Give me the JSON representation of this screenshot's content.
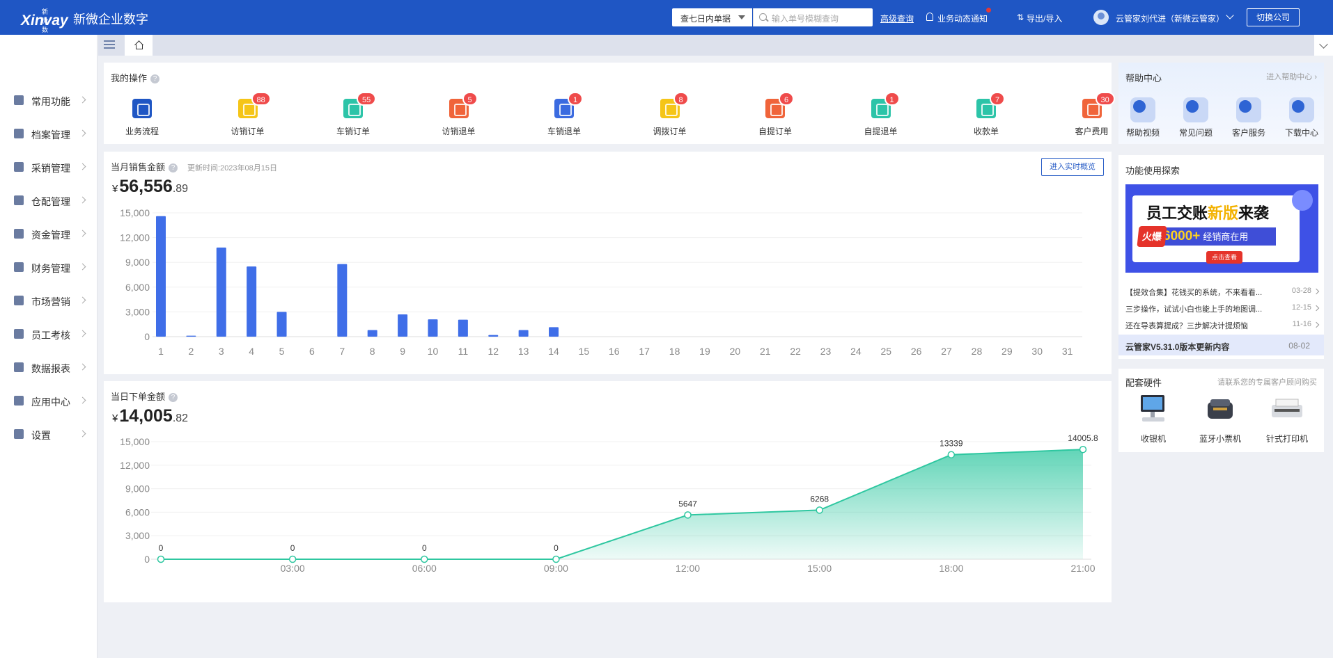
{
  "header": {
    "logo_text": "Xinvay",
    "logo_sub": "新微数字",
    "app_name": "新微企业数字",
    "scope_select": "查七日内单据",
    "search_placeholder": "输入单号模糊查询",
    "advanced_query": "高级查询",
    "notifications": "业务动态通知",
    "export_import": "导出/导入",
    "user": "云管家刘代进（新微云管家）",
    "switch_company": "切换公司",
    "brand_color": "#1f56c4"
  },
  "sidebar": {
    "items": [
      {
        "label": "常用功能",
        "icon": "star-icon"
      },
      {
        "label": "档案管理",
        "icon": "grid-icon"
      },
      {
        "label": "采销管理",
        "icon": "clipboard-icon"
      },
      {
        "label": "仓配管理",
        "icon": "warehouse-icon"
      },
      {
        "label": "资金管理",
        "icon": "money-bag-icon"
      },
      {
        "label": "财务管理",
        "icon": "calculator-icon"
      },
      {
        "label": "市场营销",
        "icon": "shop-icon"
      },
      {
        "label": "员工考核",
        "icon": "people-icon"
      },
      {
        "label": "数据报表",
        "icon": "chart-icon"
      },
      {
        "label": "应用中心",
        "icon": "apps-icon"
      },
      {
        "label": "设置",
        "icon": "gear-icon"
      }
    ]
  },
  "ops": {
    "title": "我的操作",
    "items": [
      {
        "label": "业务流程",
        "badge": "",
        "color": "#1f56c4"
      },
      {
        "label": "访销订单",
        "badge": "88",
        "color": "#f5c518"
      },
      {
        "label": "车销订单",
        "badge": "55",
        "color": "#2cc4a8"
      },
      {
        "label": "访销退单",
        "badge": "5",
        "color": "#f0643a"
      },
      {
        "label": "车销退单",
        "badge": "1",
        "color": "#3b6be0"
      },
      {
        "label": "调拨订单",
        "badge": "8",
        "color": "#f5c518"
      },
      {
        "label": "自提订单",
        "badge": "6",
        "color": "#f0643a"
      },
      {
        "label": "自提退单",
        "badge": "1",
        "color": "#2cc4a8"
      },
      {
        "label": "收款单",
        "badge": "7",
        "color": "#2cc4a8"
      },
      {
        "label": "客户费用",
        "badge": "30",
        "color": "#f0643a"
      }
    ]
  },
  "monthly": {
    "title": "当月销售金额",
    "updated": "更新时间:2023年08月15日",
    "currency": "¥",
    "amount_int": "56,556",
    "amount_dec": ".89",
    "realtime_button": "进入实时概览"
  },
  "daily": {
    "title": "当日下单金额",
    "currency": "¥",
    "amount_int": "14,005",
    "amount_dec": ".82"
  },
  "chart_data": [
    {
      "type": "bar",
      "categories": [
        "1",
        "2",
        "3",
        "4",
        "5",
        "6",
        "7",
        "8",
        "9",
        "10",
        "11",
        "12",
        "13",
        "14",
        "15",
        "16",
        "17",
        "18",
        "19",
        "20",
        "21",
        "22",
        "23",
        "24",
        "25",
        "26",
        "27",
        "28",
        "29",
        "30",
        "31"
      ],
      "values": [
        14600,
        120,
        10800,
        8500,
        3000,
        0,
        8800,
        800,
        2700,
        2100,
        2050,
        200,
        800,
        1150,
        0,
        0,
        0,
        0,
        0,
        0,
        0,
        0,
        0,
        0,
        0,
        0,
        0,
        0,
        0,
        0,
        0
      ],
      "yticks": [
        "0",
        "3,000",
        "6,000",
        "9,000",
        "12,000",
        "15,000"
      ],
      "ylim": [
        0,
        15000
      ],
      "color": "#3f6ee8"
    },
    {
      "type": "area",
      "x": [
        "00:00",
        "03:00",
        "06:00",
        "09:00",
        "12:00",
        "15:00",
        "18:00",
        "21:00"
      ],
      "xticks": [
        "03:00",
        "06:00",
        "09:00",
        "12:00",
        "15:00",
        "18:00",
        "21:00"
      ],
      "values": [
        0,
        0,
        0,
        0,
        5647,
        6268,
        13339,
        14005.8
      ],
      "labels": [
        "0",
        "0",
        "0",
        "0",
        "5647",
        "6268",
        "13339",
        "14005.8"
      ],
      "yticks": [
        "0",
        "3,000",
        "6,000",
        "9,000",
        "12,000",
        "15,000"
      ],
      "ylim": [
        0,
        15000
      ],
      "color": "#2ec7a0"
    }
  ],
  "help": {
    "title": "帮助中心",
    "link": "进入帮助中心",
    "items": [
      {
        "label": "帮助视频",
        "icon": "video-icon"
      },
      {
        "label": "常见问题",
        "icon": "question-icon"
      },
      {
        "label": "客户服务",
        "icon": "headset-icon"
      },
      {
        "label": "下载中心",
        "icon": "download-icon"
      }
    ]
  },
  "explore": {
    "title": "功能使用探索",
    "banner": {
      "title_a": "员工交账",
      "title_hl": "新版",
      "title_b": "来袭",
      "hot": "火爆",
      "count": "6000+",
      "count_text": "经销商在用",
      "cta": "点击查看"
    },
    "news": [
      {
        "title": "【提效合集】花钱买的系统，不来看看...",
        "date": "03-28"
      },
      {
        "title": "三步操作，试试小白也能上手的地图调...",
        "date": "12-15"
      },
      {
        "title": "还在导表算提成？三步解决计提烦恼",
        "date": "11-16"
      }
    ],
    "update_title": "云管家V5.31.0版本更新内容",
    "update_date": "08-02"
  },
  "hardware": {
    "title": "配套硬件",
    "link": "请联系您的专属客户顾问购买",
    "items": [
      {
        "label": "收银机",
        "icon": "pos-terminal-icon"
      },
      {
        "label": "蓝牙小票机",
        "icon": "receipt-printer-icon"
      },
      {
        "label": "针式打印机",
        "icon": "dot-matrix-printer-icon"
      }
    ]
  }
}
